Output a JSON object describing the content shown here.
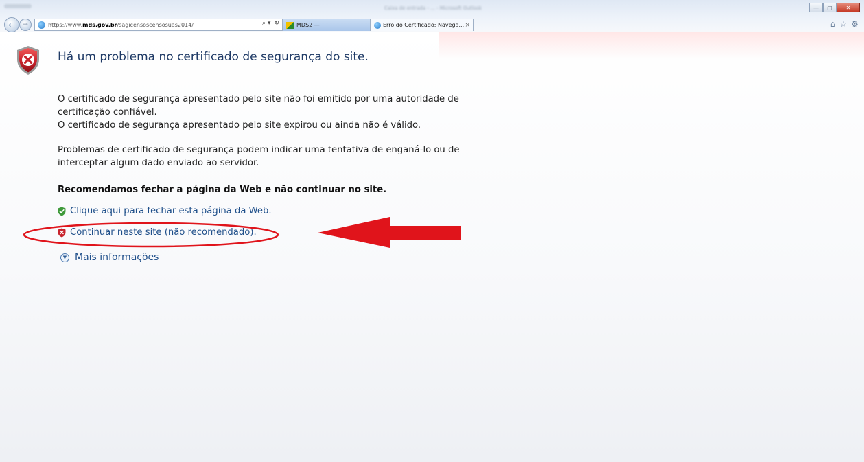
{
  "browser": {
    "window_title_blurred": "Caixa de entrada - ... - Microsoft Outlook",
    "address_url_prefix": "https://www.",
    "address_url_host": "mds.gov.br",
    "address_url_path": "/sagicensoscensosuas2014/",
    "address_tools": [
      "⌕ ▾",
      "↻"
    ],
    "tabs": [
      {
        "label": "MDS2 —",
        "icon": "mds-tab-icon",
        "active": false
      },
      {
        "label": "Erro do Certificado: Navega...",
        "icon": "ie-tab-icon",
        "active": true,
        "close": "×"
      }
    ],
    "nav": {
      "back_glyph": "←",
      "forward_glyph": "→"
    },
    "window_controls": {
      "minimize": "—",
      "maximize": "▢",
      "close": "✕"
    },
    "toolbar_icons": [
      "⌂",
      "☆",
      "⚙"
    ]
  },
  "page": {
    "heading": "Há um problema no certificado de segurança do site.",
    "paragraph1": "O certificado de segurança apresentado pelo site não foi emitido por uma autoridade de certificação confiável.",
    "paragraph2": "O certificado de segurança apresentado pelo site expirou ou ainda não é válido.",
    "paragraph3": "Problemas de certificado de segurança podem indicar uma tentativa de enganá-lo ou de interceptar algum dado enviado ao servidor.",
    "recommendation": "Recomendamos fechar a página da Web e não continuar no site.",
    "close_link": "Clique aqui para fechar esta página da Web.",
    "continue_link": "Continuar neste site (não recomendado).",
    "more_info": "Mais informações"
  },
  "colors": {
    "heading": "#1f3a66",
    "link": "#1f4f8a",
    "annotation_red": "#e0141b",
    "shield_red": "#c8232c",
    "shield_green": "#3f9a3a"
  },
  "icons": {
    "main": "error-shield-icon",
    "close_link": "green-check-shield-icon",
    "continue_link": "red-x-shield-icon",
    "more_info": "expand-chevron-icon"
  }
}
